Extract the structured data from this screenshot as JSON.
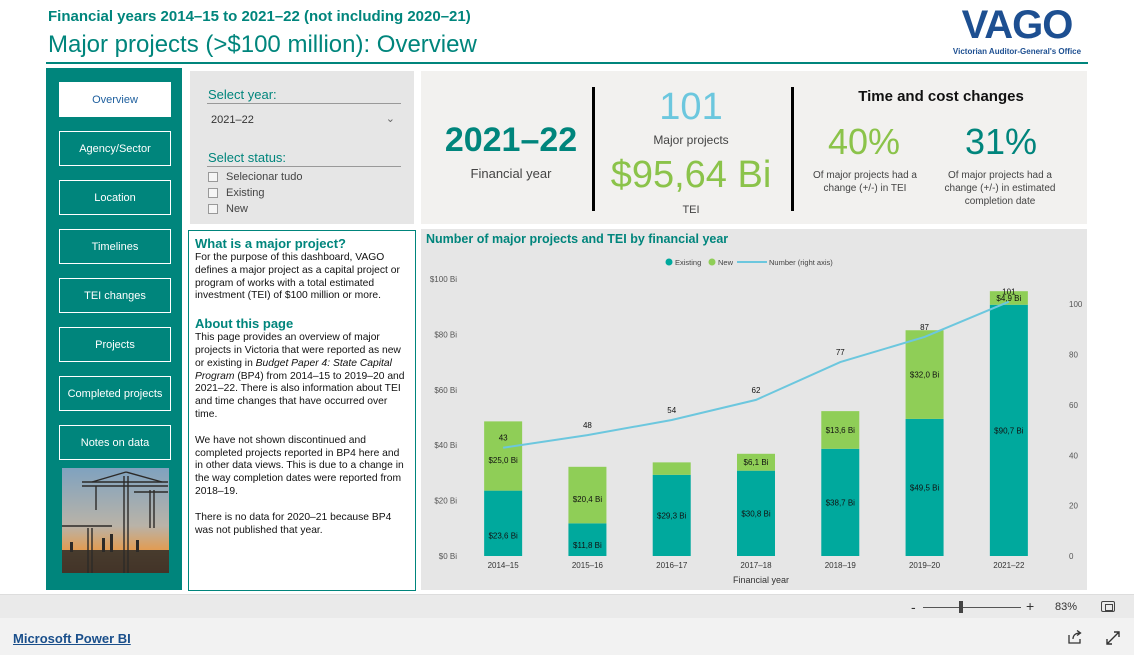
{
  "header": {
    "subtitle": "Financial years 2014–15 to 2021–22 (not including 2020–21)",
    "title": "Major projects (>$100 million): Overview",
    "logo_word": "VAGO",
    "logo_sub": "Victorian Auditor-General's Office"
  },
  "nav": {
    "items": [
      {
        "label": "Overview",
        "active": true
      },
      {
        "label": "Agency/Sector"
      },
      {
        "label": "Location"
      },
      {
        "label": "Timelines"
      },
      {
        "label": "TEI changes"
      },
      {
        "label": "Projects"
      },
      {
        "label": "Completed projects"
      },
      {
        "label": "Notes on data"
      }
    ]
  },
  "filters": {
    "year_label": "Select year:",
    "year_value": "2021–22",
    "status_label": "Select status:",
    "status_options": [
      "Selecionar tudo",
      "Existing",
      "New"
    ]
  },
  "kpi": {
    "year": "2021–22",
    "year_label": "Financial year",
    "projects": "101",
    "projects_label": "Major projects",
    "tei": "$95,64 Bi",
    "tei_label": "TEI",
    "changes_title": "Time and cost changes",
    "cost_pct": "40%",
    "cost_label": "Of major projects had a change (+/-) in TEI",
    "time_pct": "31%",
    "time_label": "Of major projects had a change (+/-) in estimated completion date"
  },
  "info": {
    "h1": "What is a major project?",
    "p1": "For the purpose of this dashboard, VAGO defines a major project as a capital project or program of works with a total estimated investment (TEI) of $100 million or more.",
    "h2": "About this page",
    "p2a": "This page provides an overview of major projects in Victoria that were reported as new or existing in ",
    "p2_italic": "Budget Paper 4: State Capital Program",
    "p2b": " (BP4) from 2014–15 to 2019–20 and 2021–22. There is also information about TEI and time changes that have occurred over time.",
    "p3": "We have not shown discontinued and completed projects reported in BP4 here and in other data views. This is due to a change in the way completion dates were reported from 2018–19.",
    "p4": "There is no data for 2020–21 because BP4 was not published that year."
  },
  "chart_data": {
    "type": "bar",
    "title": "Number of major projects and TEI by financial year",
    "xlabel": "Financial year",
    "ylabel": "",
    "y2label": "",
    "categories": [
      "2014–15",
      "2015–16",
      "2016–17",
      "2017–18",
      "2018–19",
      "2019–20",
      "2021–22"
    ],
    "series": [
      {
        "name": "Existing",
        "values": [
          23.6,
          11.8,
          29.3,
          30.8,
          38.7,
          49.5,
          90.7
        ],
        "labels": [
          "$23,6 Bi",
          "$11,8 Bi",
          "$29,3 Bi",
          "$30,8 Bi",
          "$38,7 Bi",
          "$49,5 Bi",
          "$90,7 Bi"
        ],
        "color": "#00a99d"
      },
      {
        "name": "New",
        "values": [
          25.0,
          20.4,
          4.5,
          6.1,
          13.6,
          32.0,
          4.9
        ],
        "labels": [
          "$25,0 Bi",
          "$20,4 Bi",
          "",
          "$6,1 Bi",
          "$13,6 Bi",
          "$32,0 Bi",
          "$4,9 Bi"
        ],
        "color": "#8fce57"
      }
    ],
    "line": {
      "name": "Number (right axis)",
      "values": [
        43,
        48,
        54,
        62,
        77,
        87,
        101
      ],
      "color": "#6cc7de"
    },
    "ylim": [
      0,
      100
    ],
    "yticks": [
      "$0 Bi",
      "$20 Bi",
      "$40 Bi",
      "$60 Bi",
      "$80 Bi",
      "$100 Bi"
    ],
    "y2lim": [
      0,
      110
    ],
    "y2ticks": [
      "0",
      "20",
      "40",
      "60",
      "80",
      "100"
    ],
    "legend_position": "top-center"
  },
  "zoom": {
    "minus": "-",
    "plus": "+",
    "percent": "83%"
  },
  "footer": {
    "link": "Microsoft Power BI"
  }
}
